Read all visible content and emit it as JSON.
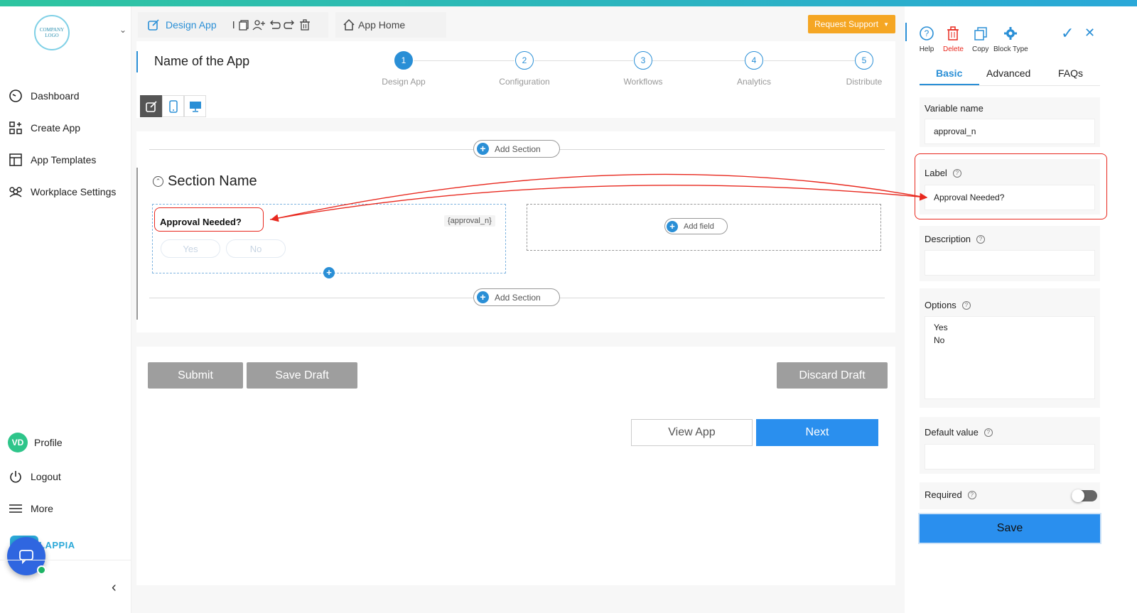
{
  "sidebar": {
    "logo_text": "COMPANY LOGO",
    "items": [
      {
        "label": "Dashboard",
        "icon": "gauge-icon"
      },
      {
        "label": "Create App",
        "icon": "grid-plus-icon"
      },
      {
        "label": "App Templates",
        "icon": "layout-icon"
      },
      {
        "label": "Workplace Settings",
        "icon": "users-gear-icon"
      }
    ],
    "bottom_items": [
      {
        "label": "Profile",
        "avatar": "VD"
      },
      {
        "label": "Logout",
        "icon": "power-icon"
      },
      {
        "label": "More",
        "icon": "menu-icon"
      }
    ],
    "brand": "LAPPIA"
  },
  "header": {
    "tab_design": "Design App",
    "tab_home": "App Home",
    "request_support": "Request Support"
  },
  "app": {
    "name": "Name of the App",
    "steps": [
      {
        "num": "1",
        "label": "Design App"
      },
      {
        "num": "2",
        "label": "Configuration"
      },
      {
        "num": "3",
        "label": "Workflows"
      },
      {
        "num": "4",
        "label": "Analytics"
      },
      {
        "num": "5",
        "label": "Distribute"
      }
    ]
  },
  "canvas": {
    "add_section": "Add Section",
    "section_name": "Section Name",
    "field_label": "Approval Needed?",
    "field_var": "{approval_n}",
    "options": [
      "Yes",
      "No"
    ],
    "add_field": "Add field"
  },
  "footer": {
    "submit": "Submit",
    "save_draft": "Save Draft",
    "discard_draft": "Discard Draft",
    "view_app": "View App",
    "next": "Next"
  },
  "panel": {
    "tools": [
      "Help",
      "Delete",
      "Copy",
      "Block Type"
    ],
    "tabs": [
      "Basic",
      "Advanced",
      "FAQs"
    ],
    "variable_name_label": "Variable name",
    "variable_name_value": "approval_n",
    "label_label": "Label",
    "label_value": "Approval Needed?",
    "description_label": "Description",
    "options_label": "Options",
    "options_values": [
      "Yes",
      "No"
    ],
    "default_value_label": "Default value",
    "required_label": "Required",
    "save": "Save"
  },
  "colors": {
    "accent": "#2a8fd6",
    "support": "#f5a623",
    "annotation": "#e8281e"
  }
}
